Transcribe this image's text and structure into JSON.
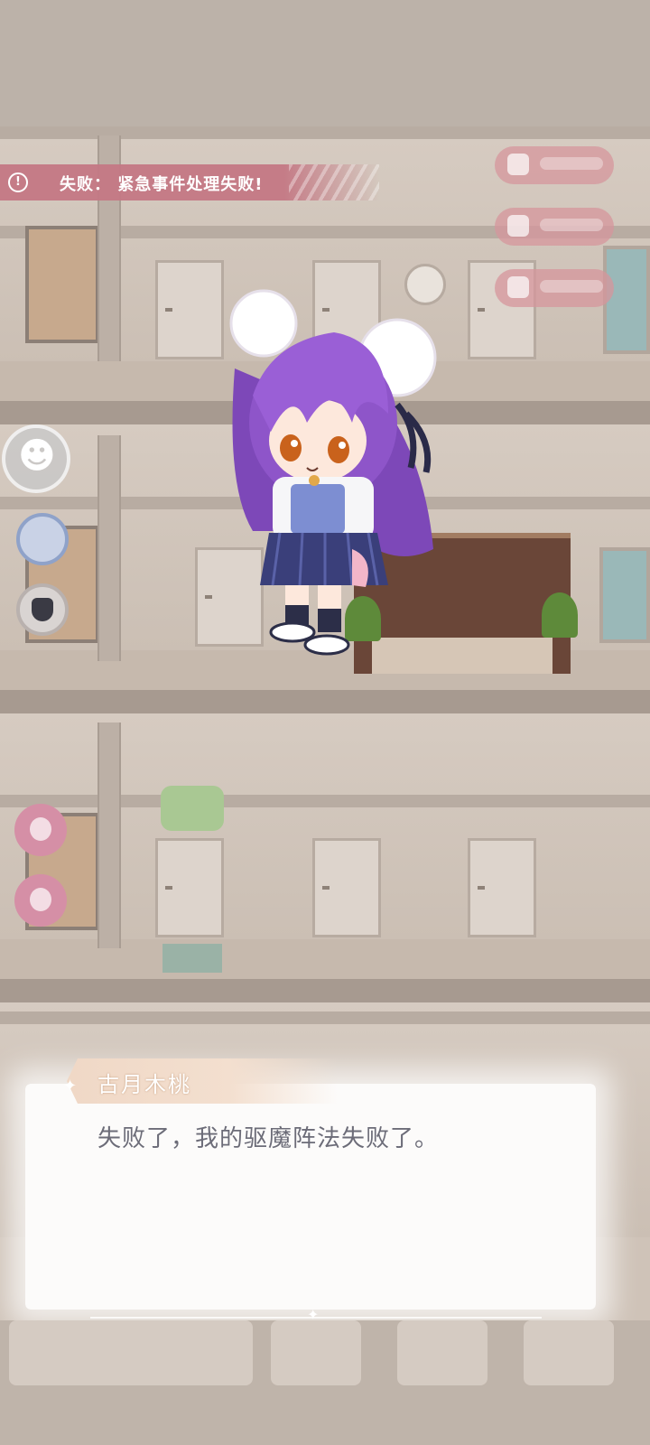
{
  "banner": {
    "icon": "alert-circle-icon",
    "text": "失败：  紧急事件处理失败!"
  },
  "dialog": {
    "speaker": "古月木桃",
    "line": "失败了，我的驱魔阵法失败了。"
  },
  "character": {
    "hair_color": "#8e55c9",
    "skirt_color": "#3a3f7a"
  },
  "colors": {
    "banner": "#c47884",
    "pill": "#d6969c",
    "nameplate": "#f0d8c6"
  }
}
